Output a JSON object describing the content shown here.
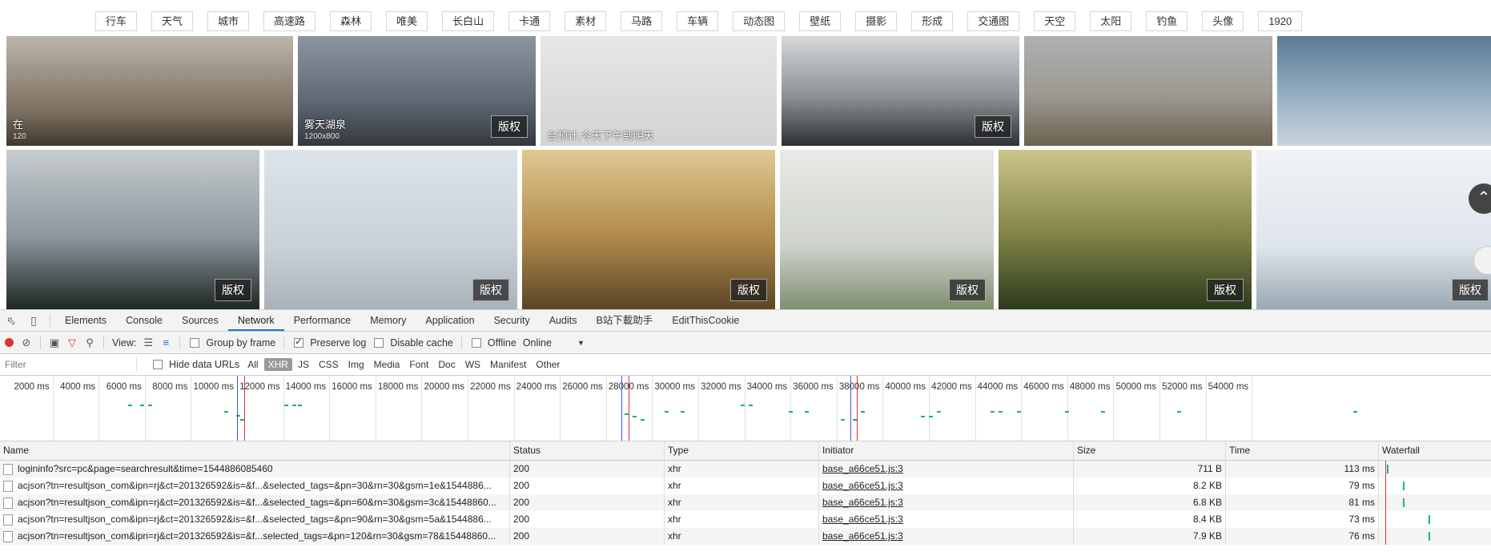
{
  "tags": [
    "行车",
    "天气",
    "城市",
    "高速路",
    "森林",
    "唯美",
    "长白山",
    "卡通",
    "素材",
    "马路",
    "车辆",
    "动态图",
    "壁纸",
    "摄影",
    "形成",
    "交通图",
    "天空",
    "太阳",
    "钓鱼",
    "头像",
    "1920"
  ],
  "images": {
    "copyright_badge": "版权",
    "row1": [
      {
        "w": 358,
        "bg": "linear-gradient(#bdb5ab,#7a6e5e 70%,#3e3a2e)",
        "caption": "在",
        "size": "120"
      },
      {
        "w": 297,
        "bg": "linear-gradient(#8b96a0,#5d6872 60%,#34383c)",
        "caption": "雾天湖泉",
        "size": "1200x800",
        "copy": true
      },
      {
        "w": 295,
        "bg": "linear-gradient(#e6e7e8,#d2d3d4)",
        "caption": "台预计,今天下午到明天"
      },
      {
        "w": 297,
        "bg": "linear-gradient(#d6d8da,#8c9296 55%,#2e3134)",
        "copy": true
      },
      {
        "w": 310,
        "bg": "linear-gradient(#aeb0b2,#9c9890 55%,#6b6150)"
      },
      {
        "w": 270,
        "bg": "linear-gradient(#5a7a95,#9db4c6 60%,#c7d4de)"
      }
    ],
    "row2": [
      {
        "w": 316,
        "bg": "linear-gradient(#c6ccd0,#8d979c 55%,#1e2624)",
        "copy": true
      },
      {
        "w": 316,
        "bg": "linear-gradient(#dde4ea,#c9d2d8 60%,#a9b2b6)",
        "copy": true
      },
      {
        "w": 316,
        "bg": "linear-gradient(#e0c890,#b08a4a 55%,#5b4526)",
        "copy": true
      },
      {
        "w": 267,
        "bg": "linear-gradient(#e8eae6,#cfd3cc 60%,#7f8f70)",
        "copy": true
      },
      {
        "w": 316,
        "bg": "linear-gradient(#cdc58c,#7d8244 55%,#2b3a1c)",
        "copy": true
      },
      {
        "w": 300,
        "bg": "linear-gradient(#f0f3f6,#dfe6ec 60%,#9aa8b2)",
        "copy": true
      }
    ]
  },
  "devtools": {
    "tabs": [
      "Elements",
      "Console",
      "Sources",
      "Network",
      "Performance",
      "Memory",
      "Application",
      "Security",
      "Audits",
      "B站下載助手",
      "EditThisCookie"
    ],
    "active_tab": "Network",
    "toolbar": {
      "view_label": "View:",
      "group_by_frame": "Group by frame",
      "preserve_log": "Preserve log",
      "disable_cache": "Disable cache",
      "offline": "Offline",
      "throttle": "Online"
    },
    "filter": {
      "placeholder": "Filter",
      "hide_data_urls": "Hide data URLs",
      "types": [
        "All",
        "XHR",
        "JS",
        "CSS",
        "Img",
        "Media",
        "Font",
        "Doc",
        "WS",
        "Manifest",
        "Other"
      ],
      "active_type": "XHR"
    },
    "timeline_ticks": [
      "2000 ms",
      "4000 ms",
      "6000 ms",
      "8000 ms",
      "10000 ms",
      "12000 ms",
      "14000 ms",
      "16000 ms",
      "18000 ms",
      "20000 ms",
      "22000 ms",
      "24000 ms",
      "26000 ms",
      "28000 ms",
      "30000 ms",
      "32000 ms",
      "34000 ms",
      "36000 ms",
      "38000 ms",
      "40000 ms",
      "42000 ms",
      "44000 ms",
      "46000 ms",
      "48000 ms",
      "50000 ms",
      "52000 ms",
      "54000 ms"
    ],
    "columns": {
      "name": "Name",
      "status": "Status",
      "type": "Type",
      "initiator": "Initiator",
      "size": "Size",
      "time": "Time",
      "waterfall": "Waterfall"
    },
    "requests": [
      {
        "name": "logininfo?src=pc&page=searchresult&time=1544886085460",
        "status": "200",
        "type": "xhr",
        "initiator": "base_a66ce51.js:3",
        "size": "711 B",
        "time": "113 ms"
      },
      {
        "name": "acjson?tn=resultjson_com&ipn=rj&ct=201326592&is=&f...&selected_tags=&pn=30&rn=30&gsm=1e&1544886...",
        "status": "200",
        "type": "xhr",
        "initiator": "base_a66ce51.js:3",
        "size": "8.2 KB",
        "time": "79 ms"
      },
      {
        "name": "acjson?tn=resultjson_com&ipn=rj&ct=201326592&is=&f...&selected_tags=&pn=60&rn=30&gsm=3c&15448860...",
        "status": "200",
        "type": "xhr",
        "initiator": "base_a66ce51.js:3",
        "size": "6.8 KB",
        "time": "81 ms"
      },
      {
        "name": "acjson?tn=resultjson_com&ipn=rj&ct=201326592&is=&f...&selected_tags=&pn=90&rn=30&gsm=5a&1544886...",
        "status": "200",
        "type": "xhr",
        "initiator": "base_a66ce51.js:3",
        "size": "8.4 KB",
        "time": "73 ms"
      },
      {
        "name": "acjson?tn=resultjson_com&ipn=rj&ct=201326592&is=&f...selected_tags=&pn=120&rn=30&gsm=78&15448860...",
        "status": "200",
        "type": "xhr",
        "initiator": "base_a66ce51.js:3",
        "size": "7.9 KB",
        "time": "76 ms"
      }
    ]
  }
}
